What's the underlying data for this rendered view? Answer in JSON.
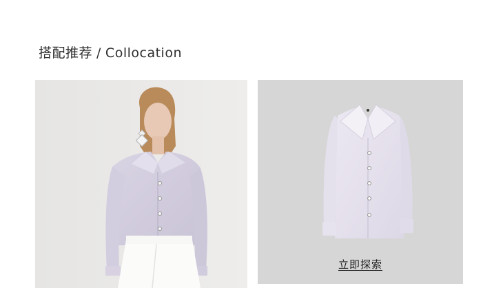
{
  "section": {
    "title_cn": "搭配推荐",
    "separator": "/",
    "title_en": "Collocation"
  },
  "product": {
    "explore_label": "立即探索"
  },
  "colors": {
    "panel_left_bg": "#e9e8e6",
    "panel_right_bg": "#d6d6d6",
    "shirt": "#d8d3e3"
  }
}
